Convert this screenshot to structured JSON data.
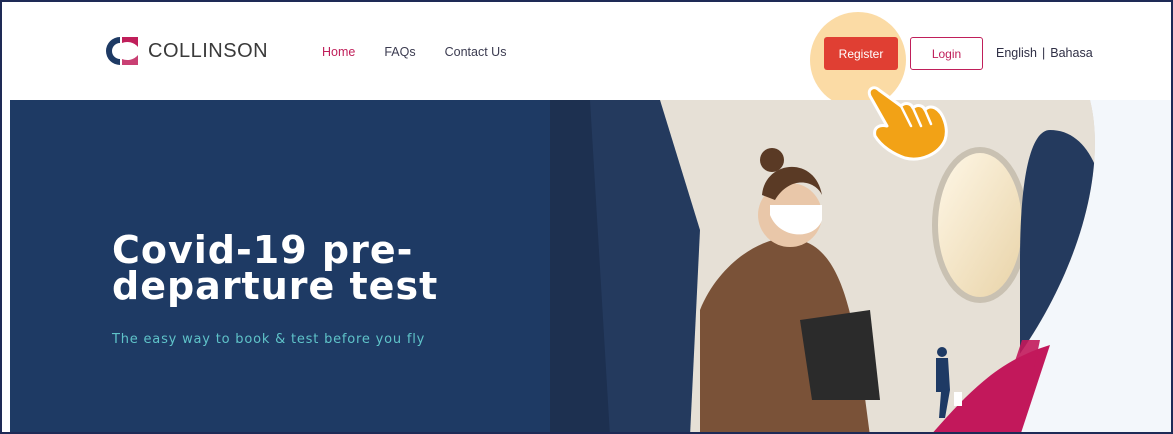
{
  "brand": {
    "name": "COLLINSON",
    "logo_icon": "collinson-logo-icon",
    "accent": "#c01f5a"
  },
  "nav": {
    "home": "Home",
    "faqs": "FAQs",
    "contact": "Contact Us"
  },
  "actions": {
    "register": "Register",
    "login": "Login"
  },
  "language": {
    "english": "English",
    "separator": "|",
    "bahasa": "Bahasa"
  },
  "hero": {
    "title_line1": "Covid-19 pre-",
    "title_line2": "departure test",
    "subtitle": "The easy way to book & test before you fly"
  },
  "colors": {
    "navy": "#1e3a64",
    "register_bg": "#e03f33",
    "teal_text": "#5fc3c9",
    "spotlight": "#fbd9a0"
  },
  "icons": {
    "pointer": "pointing-hand-icon"
  }
}
